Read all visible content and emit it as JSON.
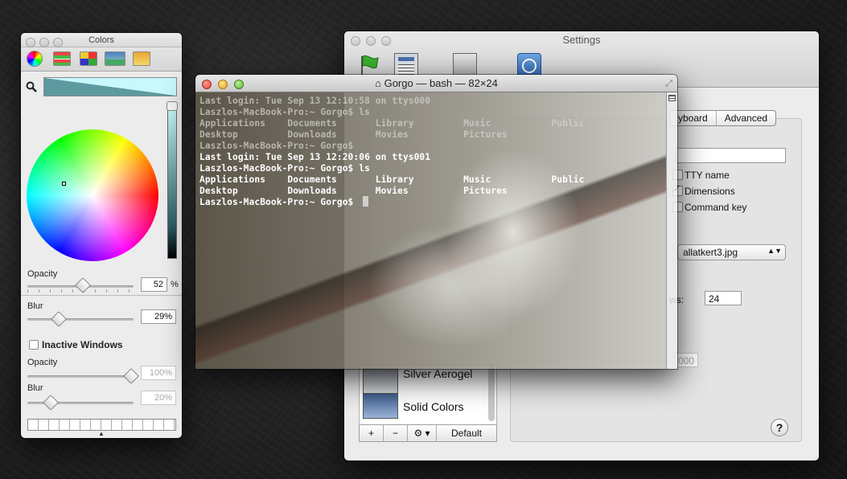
{
  "colors_panel": {
    "title": "Colors",
    "opacity_label": "Opacity",
    "opacity_value": "52",
    "percent": "%",
    "blur_label": "Blur",
    "blur_value": "29%",
    "inactive_label": "Inactive Windows",
    "inactive_checked": false,
    "inactive_opacity_label": "Opacity",
    "inactive_opacity_value": "100%",
    "inactive_blur_label": "Blur",
    "inactive_blur_value": "20%",
    "swatch_color": "#5c9aa0"
  },
  "settings": {
    "title": "Settings",
    "tabs": [
      "yboard",
      "Advanced"
    ],
    "tty_name": "TTY name",
    "dimensions": "Dimensions",
    "command_key": "Command key",
    "image_select": "allatkert3.jpg",
    "rows_label": "ws:",
    "rows_value": "24",
    "faded_value": "000",
    "profiles": [
      {
        "name": "Silver Aerogel"
      },
      {
        "name": "Solid Colors"
      }
    ],
    "bar": {
      "add": "+",
      "remove": "−",
      "gear": "⚙ ▾",
      "default": "Default"
    },
    "help": "?"
  },
  "terminal": {
    "title": "Gorgo — bash — 82×24",
    "lines": [
      "Last login: Tue Sep 13 12:10:58 on ttys000",
      "Laszlos-MacBook-Pro:~ Gorgo$ ls",
      "Applications    Documents       Library         Music           Public",
      "Desktop         Downloads       Movies          Pictures",
      "Laszlos-MacBook-Pro:~ Gorgo$",
      "Last login: Tue Sep 13 12:20:06 on ttys001",
      "Laszlos-MacBook-Pro:~ Gorgo$ ls",
      "Applications    Documents       Library         Music           Public",
      "Desktop         Downloads       Movies          Pictures",
      "Laszlos-MacBook-Pro:~ Gorgo$ "
    ]
  }
}
